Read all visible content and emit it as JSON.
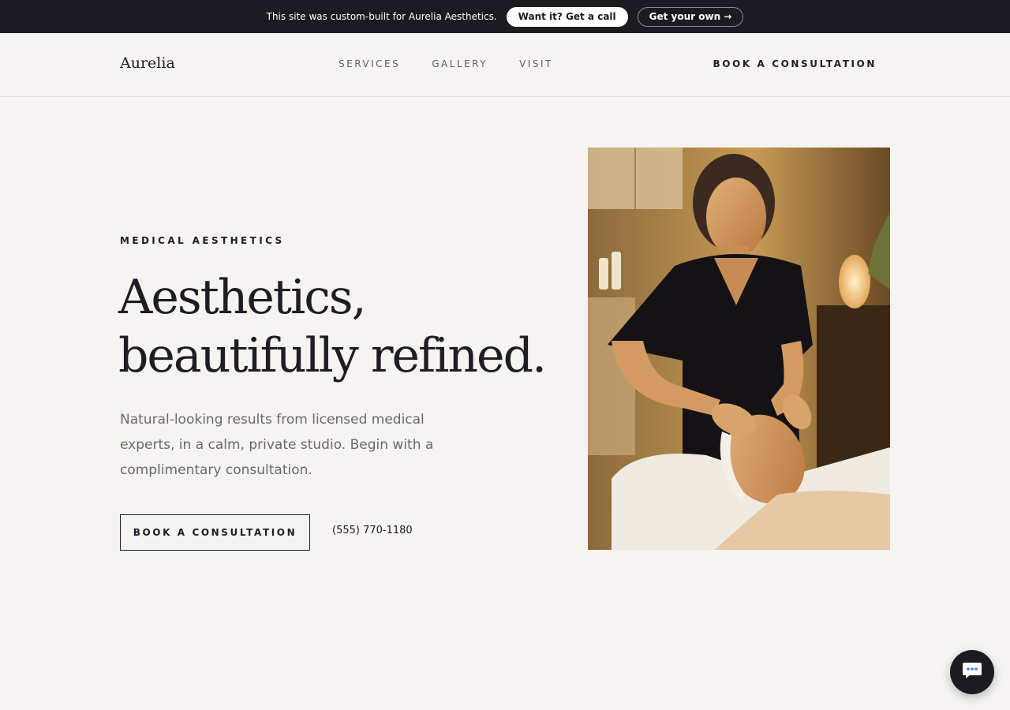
{
  "promo": {
    "text": "This site was custom-built for Aurelia Aesthetics.",
    "primary_label": "Want it? Get a call",
    "secondary_label": "Get your own →"
  },
  "header": {
    "logo": "Aurelia",
    "nav": [
      "SERVICES",
      "GALLERY",
      "VISIT"
    ],
    "cta": "BOOK A CONSULTATION"
  },
  "hero": {
    "eyebrow": "MEDICAL AESTHETICS",
    "headline_line1": "Aesthetics,",
    "headline_line2": "beautifully refined.",
    "lead": "Natural-looking results from licensed medical experts, in a calm, private studio. Begin with a complimentary consultation.",
    "cta": "BOOK A CONSULTATION",
    "phone": "(555) 770-1180"
  },
  "icons": {
    "chat": "chat-bubble-icon"
  },
  "colors": {
    "background": "#f6f4f0",
    "promo_bar": "#1c1b22",
    "ink": "#1f1c24",
    "muted": "#6a6772"
  }
}
